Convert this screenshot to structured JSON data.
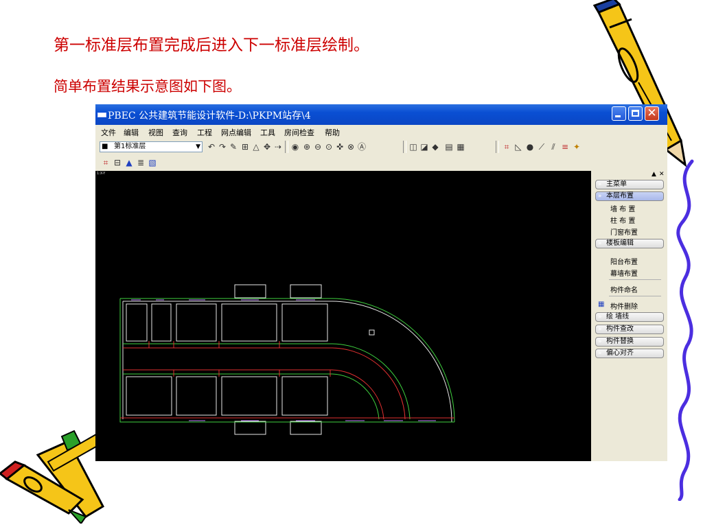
{
  "slide": {
    "line1": "第一标准层布置完成后进入下一标准层绘制。",
    "line2": "简单布置结果示意图如下图。"
  },
  "window": {
    "title": "PBEC 公共建筑节能设计软件-D:\\PKPM站存\\4",
    "close_glyph": "✕"
  },
  "menu": [
    "文件",
    "编辑",
    "视图",
    "查询",
    "工程",
    "网点编辑",
    "工具",
    "房间检查",
    "帮助"
  ],
  "toolbar": {
    "layer_value": "第1标准层"
  },
  "canvas": {
    "view_label": "1:X-Y"
  },
  "panel": {
    "headers": {
      "main_menu": "主菜单",
      "floor_layout": "本层布置",
      "slab_edit": "楼板编辑",
      "draw_wall": "绘  墙线",
      "query_edit": "构件查改",
      "replace": "构件替换",
      "eccentric": "偏心对齐"
    },
    "items": {
      "wall": "墙 布 置",
      "column": "柱 布 置",
      "door_window": "门窗布置",
      "balcony": "阳台布置",
      "curtain_wall": "幕墙布置",
      "naming": "构件命名",
      "delete": "构件删除"
    }
  },
  "colors": {
    "slide_text": "#cc0000",
    "titlebar": "#0a4fd3",
    "cad_green": "#3fd23f",
    "cad_red": "#e03030",
    "cad_white": "#e8e8e8"
  }
}
